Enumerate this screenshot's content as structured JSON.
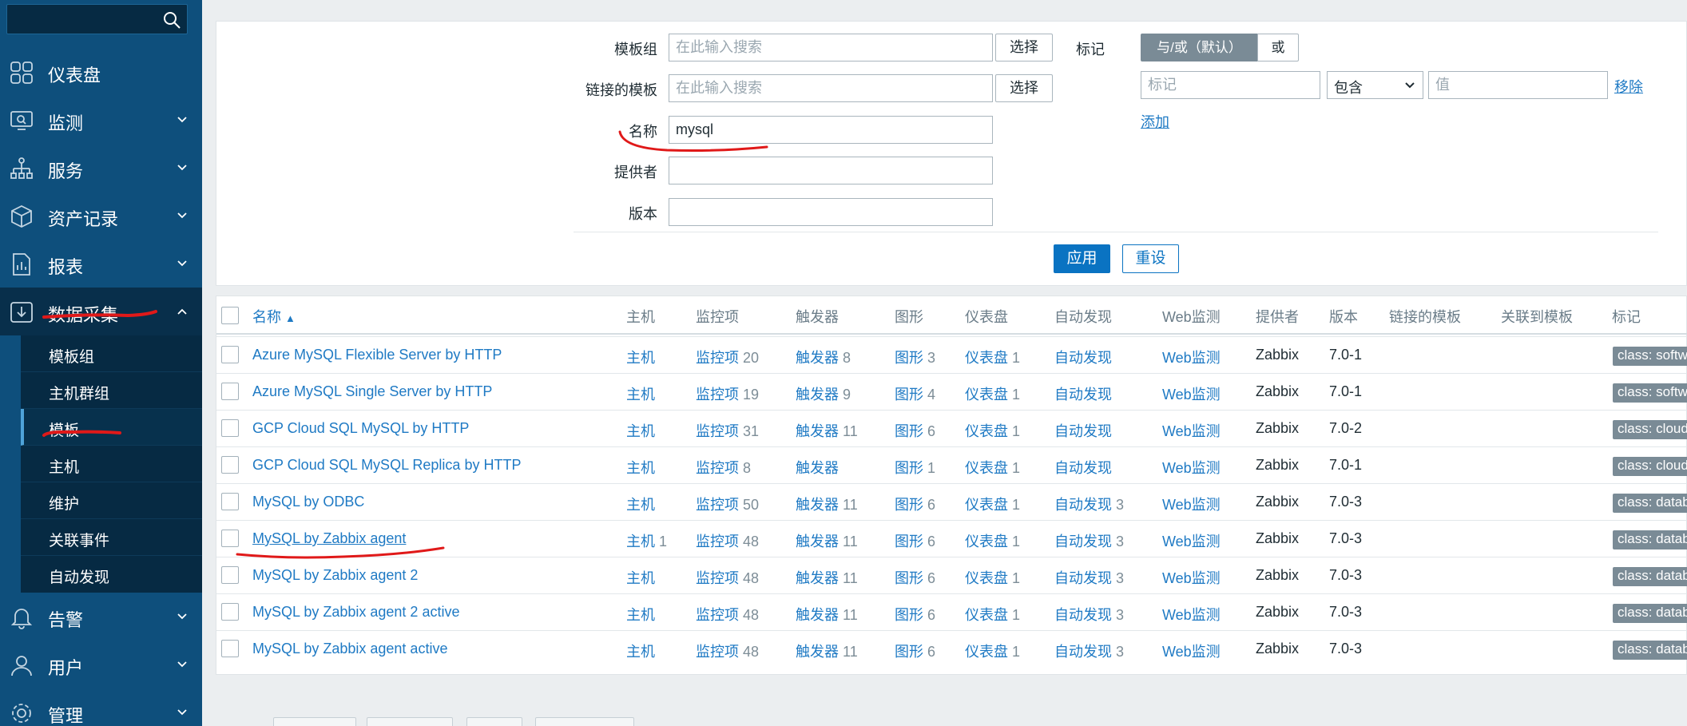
{
  "colors": {
    "sidebar_bg": "#0e4f7c",
    "sidebar_dark": "#062a43",
    "link": "#1f7ac4",
    "primary": "#0a73c2",
    "tag_bg": "#7a8b96",
    "annotation": "#e01919"
  },
  "sidebar": {
    "menu": [
      {
        "label": "仪表盘",
        "icon": "dashboard-grid-icon",
        "chevron": false
      },
      {
        "label": "监测",
        "icon": "monitoring-icon",
        "chevron": true
      },
      {
        "label": "服务",
        "icon": "services-tree-icon",
        "chevron": true
      },
      {
        "label": "资产记录",
        "icon": "inventory-box-icon",
        "chevron": true
      },
      {
        "label": "报表",
        "icon": "reports-icon",
        "chevron": true
      },
      {
        "label": "数据采集",
        "icon": "data-collection-icon",
        "chevron": true,
        "expanded": true
      },
      {
        "label": "告警",
        "icon": "alerts-bell-icon",
        "chevron": true
      },
      {
        "label": "用户",
        "icon": "users-icon",
        "chevron": true
      },
      {
        "label": "管理",
        "icon": "administration-gear-icon",
        "chevron": true
      }
    ],
    "submenu": [
      "模板组",
      "主机群组",
      "模板",
      "主机",
      "维护",
      "关联事件",
      "自动发现"
    ],
    "selected_submenu": "模板"
  },
  "filter": {
    "template_group_label": "模板组",
    "template_group_placeholder": "在此输入搜索",
    "linked_templates_label": "链接的模板",
    "linked_templates_placeholder": "在此输入搜索",
    "select_label": "选择",
    "name_label": "名称",
    "name_value": "mysql",
    "vendor_label": "提供者",
    "vendor_value": "",
    "version_label": "版本",
    "version_value": "",
    "tags_label": "标记",
    "tags_mode_and_or": "与/或（默认）",
    "tags_mode_or": "或",
    "tag_placeholder": "标记",
    "tag_operator": "包含",
    "tag_operator_options": [
      "包含"
    ],
    "tag_value_placeholder": "值",
    "remove_label": "移除",
    "add_label": "添加",
    "apply_label": "应用",
    "reset_label": "重设"
  },
  "table": {
    "headers": {
      "name": "名称",
      "hosts": "主机",
      "items": "监控项",
      "triggers": "触发器",
      "graphs": "图形",
      "dashboards": "仪表盘",
      "discovery": "自动发现",
      "web": "Web监测",
      "vendor": "提供者",
      "version": "版本",
      "linked_templates": "链接的模板",
      "linked_to_templates": "关联到模板",
      "tags": "标记"
    },
    "sort_indicator": "▲",
    "rows": [
      {
        "name": "Azure MySQL Flexible Server by HTTP",
        "hosts": "主机",
        "hosts_count": "",
        "items": "监控项",
        "items_count": "20",
        "triggers": "触发器",
        "triggers_count": "8",
        "graphs": "图形",
        "graphs_count": "3",
        "dashboards": "仪表盘",
        "dashboards_count": "1",
        "discovery": "自动发现",
        "discovery_count": "",
        "web": "Web监测",
        "vendor": "Zabbix",
        "version": "7.0-1",
        "tag": "class: software"
      },
      {
        "name": "Azure MySQL Single Server by HTTP",
        "hosts": "主机",
        "hosts_count": "",
        "items": "监控项",
        "items_count": "19",
        "triggers": "触发器",
        "triggers_count": "9",
        "graphs": "图形",
        "graphs_count": "4",
        "dashboards": "仪表盘",
        "dashboards_count": "1",
        "discovery": "自动发现",
        "discovery_count": "",
        "web": "Web监测",
        "vendor": "Zabbix",
        "version": "7.0-1",
        "tag": "class: software"
      },
      {
        "name": "GCP Cloud SQL MySQL by HTTP",
        "hosts": "主机",
        "hosts_count": "",
        "items": "监控项",
        "items_count": "31",
        "triggers": "触发器",
        "triggers_count": "11",
        "graphs": "图形",
        "graphs_count": "6",
        "dashboards": "仪表盘",
        "dashboards_count": "1",
        "discovery": "自动发现",
        "discovery_count": "",
        "web": "Web监测",
        "vendor": "Zabbix",
        "version": "7.0-2",
        "tag": "class: cloud"
      },
      {
        "name": "GCP Cloud SQL MySQL Replica by HTTP",
        "hosts": "主机",
        "hosts_count": "",
        "items": "监控项",
        "items_count": "8",
        "triggers": "触发器",
        "triggers_count": "",
        "graphs": "图形",
        "graphs_count": "1",
        "dashboards": "仪表盘",
        "dashboards_count": "1",
        "discovery": "自动发现",
        "discovery_count": "",
        "web": "Web监测",
        "vendor": "Zabbix",
        "version": "7.0-1",
        "tag": "class: cloud"
      },
      {
        "name": "MySQL by ODBC",
        "hosts": "主机",
        "hosts_count": "",
        "items": "监控项",
        "items_count": "50",
        "triggers": "触发器",
        "triggers_count": "11",
        "graphs": "图形",
        "graphs_count": "6",
        "dashboards": "仪表盘",
        "dashboards_count": "1",
        "discovery": "自动发现",
        "discovery_count": "3",
        "web": "Web监测",
        "vendor": "Zabbix",
        "version": "7.0-3",
        "tag": "class: database"
      },
      {
        "name": "MySQL by Zabbix agent",
        "hosts": "主机",
        "hosts_count": "1",
        "items": "监控项",
        "items_count": "48",
        "triggers": "触发器",
        "triggers_count": "11",
        "graphs": "图形",
        "graphs_count": "6",
        "dashboards": "仪表盘",
        "dashboards_count": "1",
        "discovery": "自动发现",
        "discovery_count": "3",
        "web": "Web监测",
        "vendor": "Zabbix",
        "version": "7.0-3",
        "tag": "class: database"
      },
      {
        "name": "MySQL by Zabbix agent 2",
        "hosts": "主机",
        "hosts_count": "",
        "items": "监控项",
        "items_count": "48",
        "triggers": "触发器",
        "triggers_count": "11",
        "graphs": "图形",
        "graphs_count": "6",
        "dashboards": "仪表盘",
        "dashboards_count": "1",
        "discovery": "自动发现",
        "discovery_count": "3",
        "web": "Web监测",
        "vendor": "Zabbix",
        "version": "7.0-3",
        "tag": "class: database"
      },
      {
        "name": "MySQL by Zabbix agent 2 active",
        "hosts": "主机",
        "hosts_count": "",
        "items": "监控项",
        "items_count": "48",
        "triggers": "触发器",
        "triggers_count": "11",
        "graphs": "图形",
        "graphs_count": "6",
        "dashboards": "仪表盘",
        "dashboards_count": "1",
        "discovery": "自动发现",
        "discovery_count": "3",
        "web": "Web监测",
        "vendor": "Zabbix",
        "version": "7.0-3",
        "tag": "class: database"
      },
      {
        "name": "MySQL by Zabbix agent active",
        "hosts": "主机",
        "hosts_count": "",
        "items": "监控项",
        "items_count": "48",
        "triggers": "触发器",
        "triggers_count": "11",
        "graphs": "图形",
        "graphs_count": "6",
        "dashboards": "仪表盘",
        "dashboards_count": "1",
        "discovery": "自动发现",
        "discovery_count": "3",
        "web": "Web监测",
        "vendor": "Zabbix",
        "version": "7.0-3",
        "tag": "class: database"
      }
    ]
  }
}
